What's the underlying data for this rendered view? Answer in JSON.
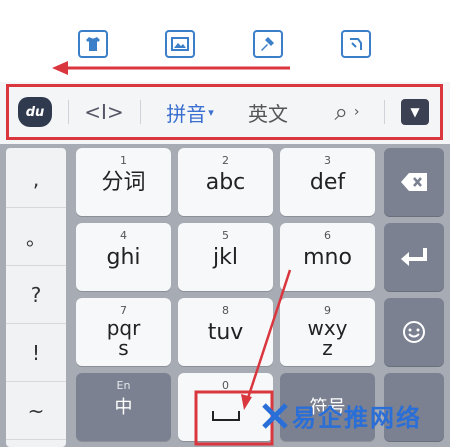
{
  "toolbar": {
    "pinyin_label": "拼音",
    "pinyin_caret": "▾",
    "english_label": "英文",
    "logo_text": "du",
    "cursor_glyph": "<I>",
    "search_glyph": "⌕",
    "more_glyph": "›"
  },
  "punctuation": [
    ",",
    "。",
    "?",
    "!",
    "~"
  ],
  "keys": [
    {
      "num": "1",
      "label": "分词"
    },
    {
      "num": "2",
      "label": "abc"
    },
    {
      "num": "3",
      "label": "def"
    },
    {
      "num": "4",
      "label": "ghi"
    },
    {
      "num": "5",
      "label": "jkl"
    },
    {
      "num": "6",
      "label": "mno"
    },
    {
      "num": "7",
      "label_top": "pqr",
      "label_bottom": "s"
    },
    {
      "num": "8",
      "label": "tuv"
    },
    {
      "num": "9",
      "label_top": "wxy",
      "label_bottom": "z"
    },
    {
      "num": "En",
      "label": "中"
    },
    {
      "num": "0",
      "label": ""
    },
    {
      "num": "",
      "label": "符号"
    }
  ],
  "watermark": {
    "text": "易企推网络"
  },
  "colors": {
    "highlight": "#d9363e",
    "accent": "#3a6fd0",
    "keyboard_bg": "#a7abb4"
  }
}
